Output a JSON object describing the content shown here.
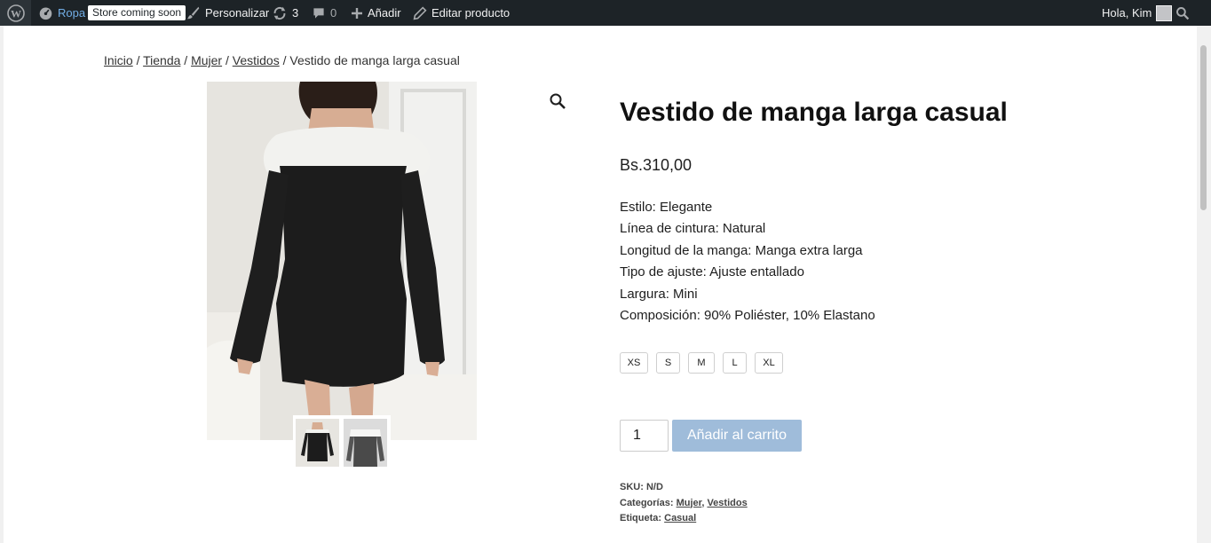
{
  "adminbar": {
    "site_name": "Ropa",
    "store_badge": "Store coming soon",
    "customize": "Personalizar",
    "updates_count": "3",
    "comments_count": "0",
    "add_new": "Añadir",
    "edit_product": "Editar producto",
    "greeting": "Hola, Kim"
  },
  "breadcrumb": {
    "items": [
      "Inicio",
      "Tienda",
      "Mujer",
      "Vestidos"
    ],
    "separator": " / ",
    "current": "Vestido de manga larga casual"
  },
  "product": {
    "title": "Vestido de manga larga casual",
    "price": "Bs.310,00",
    "description": [
      "Estilo: Elegante",
      "Línea de cintura: Natural",
      "Longitud de la manga: Manga extra larga",
      "Tipo de ajuste: Ajuste entallado",
      "Largura: Mini",
      "Composición: 90% Poliéster, 10% Elastano"
    ],
    "sizes": [
      "XS",
      "S",
      "M",
      "L",
      "XL"
    ],
    "quantity": "1",
    "add_to_cart": "Añadir al carrito",
    "meta": {
      "sku_label": "SKU:",
      "sku_value": "N/D",
      "categories_label": "Categorías:",
      "categories": [
        "Mujer",
        "Vestidos"
      ],
      "tag_label": "Etiqueta:",
      "tag": "Casual"
    }
  },
  "colors": {
    "adminbar_bg": "#1d2327",
    "button_bg": "#9fbcda",
    "dress": "#1c1c1c",
    "collar": "#f2f2ef"
  }
}
